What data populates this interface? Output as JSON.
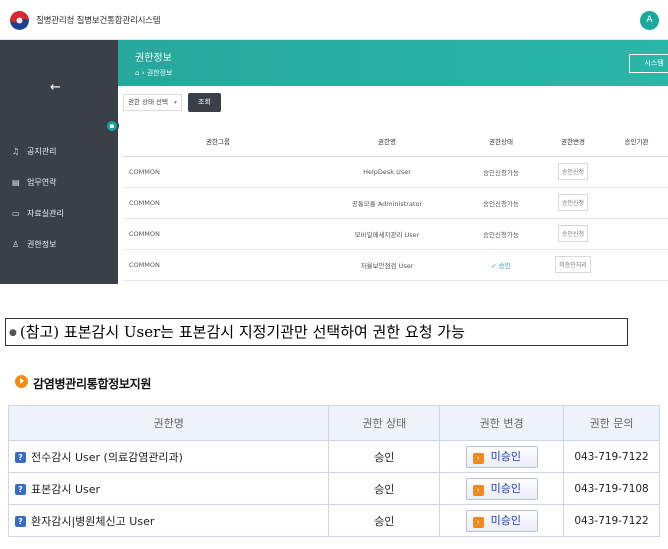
{
  "app": {
    "title": "질병관리청 질병보건통합관리시스템",
    "avatar_icon": "user-icon",
    "avatar_glyph": "A"
  },
  "sidebar": {
    "back_icon": "arrow-left-icon",
    "back_glyph": "←",
    "badge_glyph": "▪",
    "items": [
      {
        "icon": "bell-icon",
        "glyph": "♫",
        "label": "공지관리"
      },
      {
        "icon": "calendar-icon",
        "glyph": "▤",
        "label": "업무연락"
      },
      {
        "icon": "folder-icon",
        "glyph": "▭",
        "label": "자료실관리"
      },
      {
        "icon": "user-icon",
        "glyph": "♙",
        "label": "권한정보"
      }
    ]
  },
  "header": {
    "title": "권한정보",
    "breadcrumb_home_glyph": "⌂",
    "breadcrumb": "› 권한정보",
    "system_button": "시스템"
  },
  "filter": {
    "select_value": "권한 상태 선택",
    "query_button": "조회"
  },
  "permission_table": {
    "columns": [
      "권한그룹",
      "권한명",
      "권한상태",
      "권한변경",
      "승인기관"
    ],
    "rows": [
      {
        "group": "COMMON",
        "name": "HelpDesk User",
        "status": "승인신청가능",
        "action": "승인신청",
        "approved": false
      },
      {
        "group": "COMMON",
        "name": "공통모듈 Administrator",
        "status": "승인신청가능",
        "action": "승인신청",
        "approved": false
      },
      {
        "group": "COMMON",
        "name": "모바일메세지관리 User",
        "status": "승인신청가능",
        "action": "승인신청",
        "approved": false
      },
      {
        "group": "COMMON",
        "name": "자율보안점검 User",
        "status": "✓ 승인",
        "action": "미승인처리",
        "approved": true
      }
    ]
  },
  "note": {
    "bullet": "●",
    "text": "(참고) 표본감시 User는 표본감시 지정기관만 선택하여 권한 요청 가능"
  },
  "section": {
    "title": "감염병관리통합정보지원"
  },
  "service_table": {
    "columns": [
      "권한명",
      "권한 상태",
      "권한 변경",
      "권한 문의"
    ],
    "rows": [
      {
        "name": "전수감시 User (의료감염관리과)",
        "status": "승인",
        "action": "미승인",
        "phone": "043-719-7122"
      },
      {
        "name": "표본감시 User",
        "status": "승인",
        "action": "미승인",
        "phone": "043-719-7108"
      },
      {
        "name": "환자감시|병원체신고 User",
        "status": "승인",
        "action": "미승인",
        "phone": "043-719-7122"
      }
    ]
  },
  "colors": {
    "sidebar": "#3a3f48",
    "header": "#26a89b",
    "approved_text": "#1a37c9",
    "section_icon": "#f28c14"
  }
}
